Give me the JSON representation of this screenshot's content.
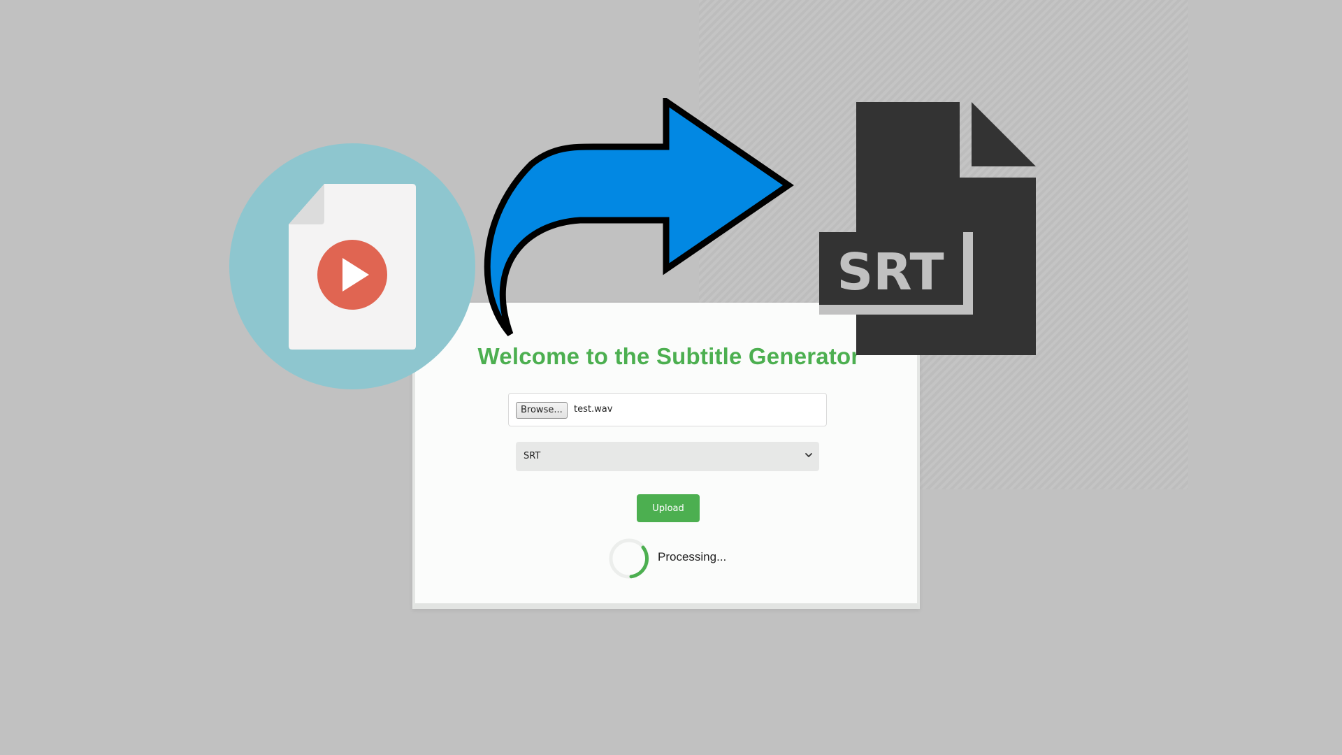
{
  "app": {
    "title": "Welcome to the Subtitle Generator"
  },
  "file_input": {
    "browse_label": "Browse...",
    "file_name": "test.wav"
  },
  "format_select": {
    "selected": "SRT"
  },
  "actions": {
    "upload_label": "Upload"
  },
  "status": {
    "processing_text": "Processing..."
  },
  "illustration": {
    "srt_label": "SRT",
    "icons": [
      "video-file-icon",
      "play-icon",
      "curved-arrow-icon",
      "srt-file-icon"
    ]
  },
  "colors": {
    "background": "#c1c1c1",
    "accent_green": "#4caf50",
    "arrow_blue": "#0288e3",
    "circle_teal": "#8ec6cf",
    "play_red": "#e06552",
    "srt_dark": "#333333"
  }
}
